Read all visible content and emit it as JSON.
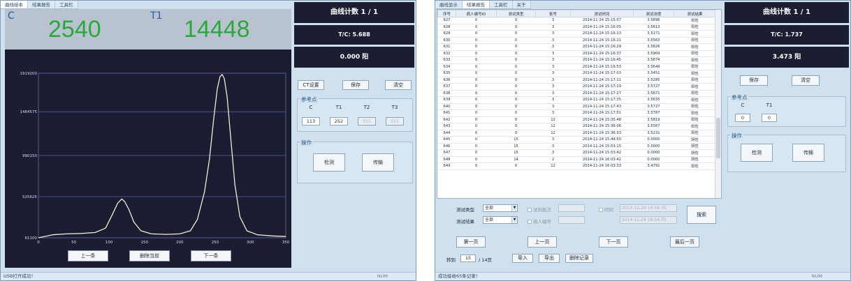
{
  "left_window": {
    "tabs": [
      "曲线绘本",
      "结果报告",
      "工具栏"
    ],
    "readout": {
      "c_label": "C",
      "c_value": "2540",
      "t1_label": "T1",
      "t1_value": "14448"
    },
    "side": {
      "count": "曲线计数 1 / 1",
      "ratio": "T/C: 5.688",
      "result": "0.000 阳"
    },
    "buttons": {
      "ct_settings": "CT设置",
      "save": "保存",
      "clear": "清空",
      "detect": "检测",
      "transfer": "传输"
    },
    "ref_group": {
      "title": "参考点",
      "labels": [
        "C",
        "T1",
        "T2",
        "T3"
      ],
      "values": [
        "113",
        "252",
        "315",
        "355"
      ]
    },
    "op_group": {
      "title": "操作"
    },
    "nav": {
      "prev": "上一条",
      "delete": "删除当前",
      "next": "下一条"
    },
    "status": {
      "text": "USB打开成功！",
      "num": "NUM"
    }
  },
  "chart_data": {
    "type": "line",
    "ylim": [
      61100,
      1919200
    ],
    "xlim": [
      0,
      350
    ],
    "yticks": [
      "1919200",
      "1484575",
      "990150",
      "525625",
      "61100"
    ],
    "ytick_values": [
      1919200,
      1484575,
      990150,
      525625,
      61100
    ],
    "xticks": [
      "0",
      "50",
      "100",
      "150",
      "200",
      "250",
      "300",
      "350"
    ],
    "xtick_values": [
      0,
      50,
      100,
      150,
      200,
      250,
      300,
      350
    ],
    "x": [
      0,
      20,
      40,
      60,
      80,
      95,
      105,
      112,
      118,
      122,
      128,
      135,
      145,
      160,
      180,
      200,
      215,
      225,
      235,
      242,
      248,
      253,
      257,
      260,
      263,
      267,
      272,
      278,
      285,
      295,
      310,
      330,
      350
    ],
    "values": [
      61100,
      95000,
      105000,
      110000,
      120000,
      170000,
      330000,
      450000,
      500000,
      470000,
      380000,
      240000,
      140000,
      105000,
      100000,
      105000,
      140000,
      270000,
      580000,
      950000,
      1400000,
      1740000,
      1880000,
      1905000,
      1860000,
      1650000,
      1200000,
      660000,
      300000,
      140000,
      95000,
      82000,
      75000
    ],
    "grid": true
  },
  "right_window": {
    "tabs": [
      "曲线显示",
      "结果报告",
      "工具栏",
      "关于"
    ],
    "columns": [
      "序号",
      "病人编号ID",
      "测试类型",
      "批号",
      "测试时间",
      "测试浓度",
      "测试结果"
    ],
    "rows": [
      [
        "627",
        "0",
        "0",
        "3",
        "2014-11-24 15:15:57",
        "3.5896",
        "阳性"
      ],
      [
        "628",
        "0",
        "0",
        "3",
        "2014-11-24 15:16:05",
        "3.5613",
        "阳性"
      ],
      [
        "629",
        "0",
        "0",
        "3",
        "2014-11-24 15:16:13",
        "3.5171",
        "阳性"
      ],
      [
        "630",
        "0",
        "0",
        "3",
        "2014-11-24 15:16:21",
        "3.5563",
        "阳性"
      ],
      [
        "631",
        "0",
        "0",
        "3",
        "2014-11-24 15:16:29",
        "3.5826",
        "阳性"
      ],
      [
        "632",
        "0",
        "0",
        "3",
        "2014-11-24 15:16:37",
        "3.5909",
        "阳性"
      ],
      [
        "633",
        "0",
        "0",
        "3",
        "2014-11-24 15:16:45",
        "3.5874",
        "阳性"
      ],
      [
        "634",
        "0",
        "0",
        "3",
        "2014-11-24 15:16:53",
        "3.5649",
        "阳性"
      ],
      [
        "635",
        "0",
        "0",
        "3",
        "2014-11-24 15:17:03",
        "3.5451",
        "阳性"
      ],
      [
        "636",
        "0",
        "0",
        "3",
        "2014-11-24 15:17:11",
        "3.5285",
        "阳性"
      ],
      [
        "637",
        "0",
        "0",
        "3",
        "2014-11-24 15:17:19",
        "3.5727",
        "阳性"
      ],
      [
        "638",
        "0",
        "0",
        "3",
        "2014-11-24 15:17:27",
        "3.5671",
        "阳性"
      ],
      [
        "639",
        "0",
        "0",
        "3",
        "2014-11-24 15:17:35",
        "3.5635",
        "阳性"
      ],
      [
        "640",
        "0",
        "0",
        "3",
        "2014-11-24 15:17:43",
        "3.5727",
        "阳性"
      ],
      [
        "641",
        "0",
        "0",
        "3",
        "2014-11-24 15:17:51",
        "3.5787",
        "阳性"
      ],
      [
        "642",
        "0",
        "0",
        "12",
        "2014-11-24 15:35:48",
        "3.5819",
        "阳性"
      ],
      [
        "643",
        "0",
        "0",
        "12",
        "2014-11-24 15:36:06",
        "3.5567",
        "阳性"
      ],
      [
        "644",
        "0",
        "0",
        "12",
        "2014-11-24 15:36:33",
        "3.5231",
        "阳性"
      ],
      [
        "645",
        "0",
        "15",
        "3",
        "2014-11-24 15:44:50",
        "0.0000",
        "阴性"
      ],
      [
        "646",
        "0",
        "15",
        "3",
        "2014-11-24 15:53:15",
        "0.0000",
        "阴性"
      ],
      [
        "647",
        "0",
        "15",
        "3",
        "2014-11-24 15:53:42",
        "0.0000",
        "阴性"
      ],
      [
        "648",
        "0",
        "14",
        "2",
        "2014-11-24 16:03:42",
        "0.0000",
        "阴性"
      ],
      [
        "649",
        "0",
        "0",
        "12",
        "2014-11-24 16:03:33",
        "3.4791",
        "阳性"
      ]
    ],
    "filters": {
      "type_label": "测试类型",
      "type_value": "全部",
      "result_label": "测试结果",
      "result_value": "全部",
      "batch_check": "试剂批次",
      "patient_check": "病人编号",
      "time_check": "时间",
      "date_from": "2014-11-24 16:04:35",
      "date_to": "2014-11-24 16:04:35",
      "search": "搜索"
    },
    "pager": {
      "first": "第一页",
      "prev": "上一页",
      "next": "下一页",
      "last": "最后一页",
      "goto_label": "转到",
      "page": "15",
      "total": "/ 14页",
      "import": "导入",
      "export": "导出",
      "delete": "删除记录"
    },
    "side": {
      "count": "曲线计数 1 / 1",
      "ratio": "T/C: 1.737",
      "result": "3.473 阳"
    },
    "buttons": {
      "save": "保存",
      "clear": "清空",
      "detect": "检测",
      "transfer": "传输"
    },
    "ref_group": {
      "title": "参考点",
      "labels": [
        "C",
        "T1"
      ],
      "values": [
        "0",
        "0"
      ]
    },
    "op_group": {
      "title": "操作"
    },
    "status": {
      "text": "成功接收65条记录！",
      "num": "NUM"
    }
  }
}
